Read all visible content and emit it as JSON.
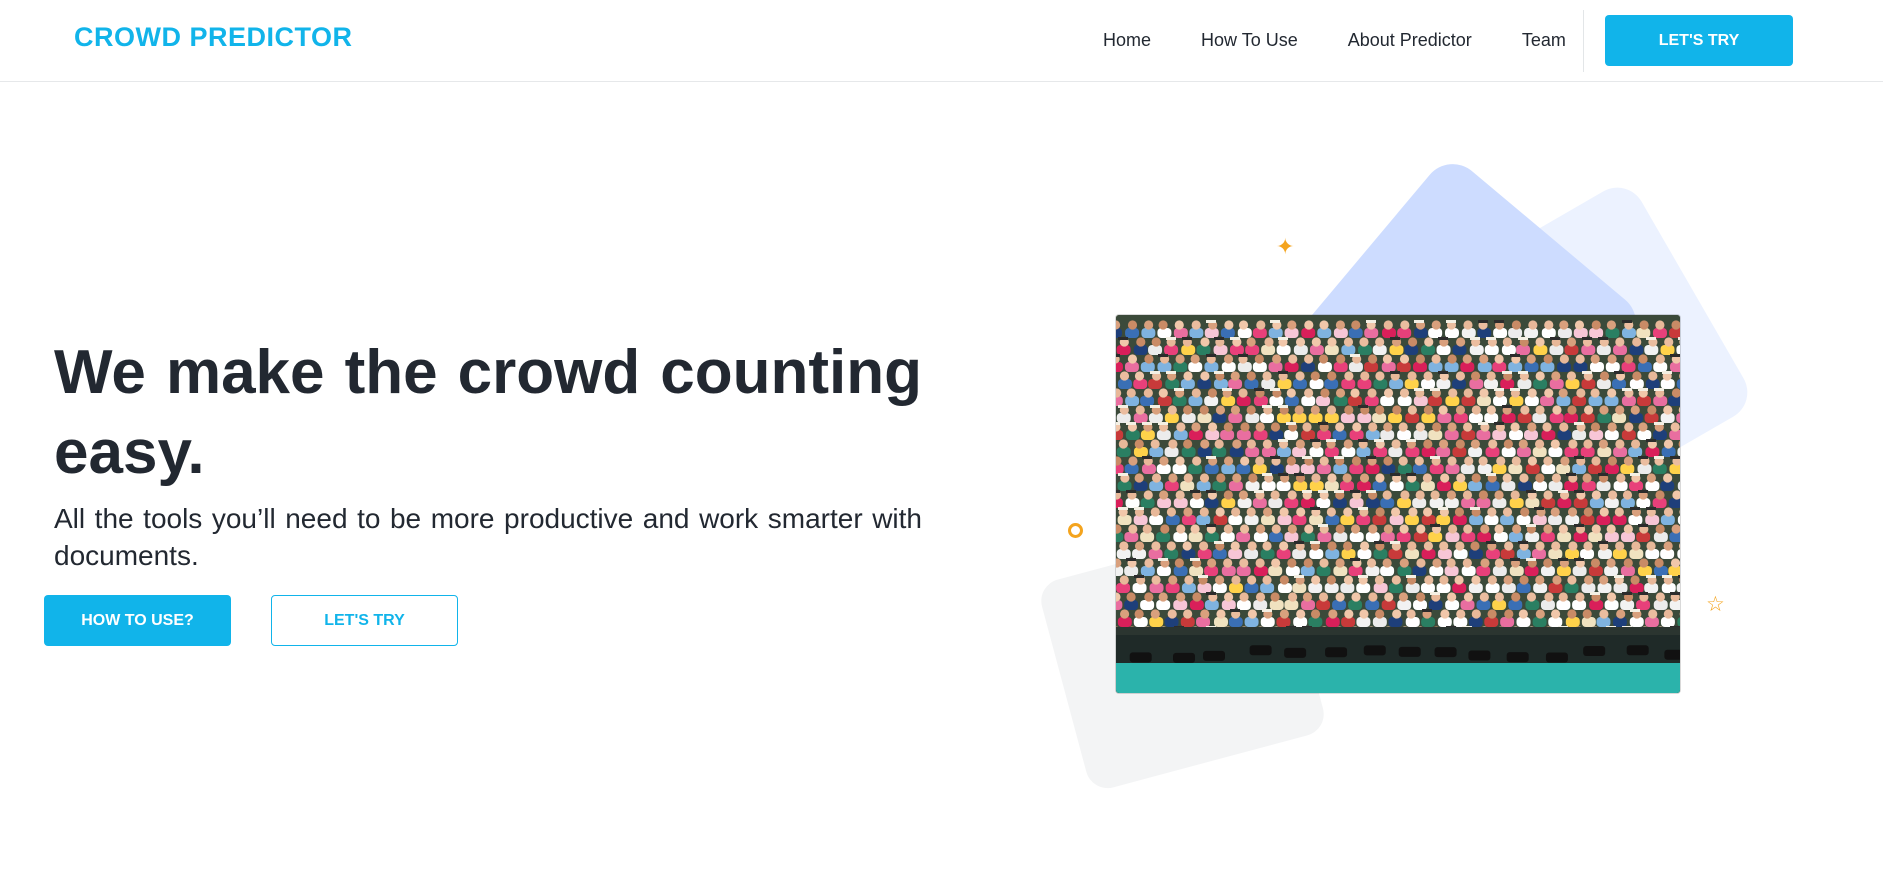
{
  "header": {
    "brand": "CROWD PREDICTOR",
    "nav": [
      {
        "label": "Home"
      },
      {
        "label": "How To Use"
      },
      {
        "label": "About Predictor"
      },
      {
        "label": "Team"
      }
    ],
    "cta_label": "LET'S TRY"
  },
  "hero": {
    "title": "We make the crowd counting easy.",
    "subtitle": "All the tools you’ll need to be more productive and work smarter with documents.",
    "primary_button": "HOW TO USE?",
    "secondary_button": "LET'S TRY"
  },
  "illustration": {
    "photo_subject": "stadium crowd",
    "decorations": [
      "sparkle-icon",
      "ring-icon",
      "star-icon"
    ]
  },
  "colors": {
    "accent": "#11b4ea",
    "text": "#222831",
    "decor_orange": "#f4a41e",
    "shape_blue": "#cddcff",
    "shape_blue_light": "#ecf2ff",
    "shape_gray": "#f3f4f5"
  }
}
